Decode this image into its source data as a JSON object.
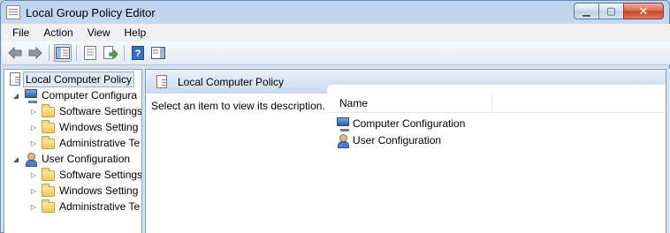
{
  "window": {
    "title": "Local Group Policy Editor",
    "minimize_label": "▁",
    "maximize_label": "▢",
    "close_label": "✕"
  },
  "menu": [
    "File",
    "Action",
    "View",
    "Help"
  ],
  "toolbar": {
    "buttons": [
      "back-arrow-icon",
      "forward-arrow-icon",
      "show-hide-console-tree-icon",
      "properties-icon",
      "export-list-icon",
      "help-icon",
      "show-action-pane-icon"
    ]
  },
  "tree": {
    "root": "Local Computer Policy",
    "computer_config": "Computer Configura",
    "computer_children": [
      "Software Settings",
      "Windows Setting",
      "Administrative Te"
    ],
    "user_config": "User Configuration",
    "user_children": [
      "Software Settings",
      "Windows Setting",
      "Administrative Te"
    ]
  },
  "details": {
    "header_title": "Local Computer Policy",
    "description": "Select an item to view its description.",
    "column_name": "Name",
    "items": [
      "Computer Configuration",
      "User Configuration"
    ]
  }
}
